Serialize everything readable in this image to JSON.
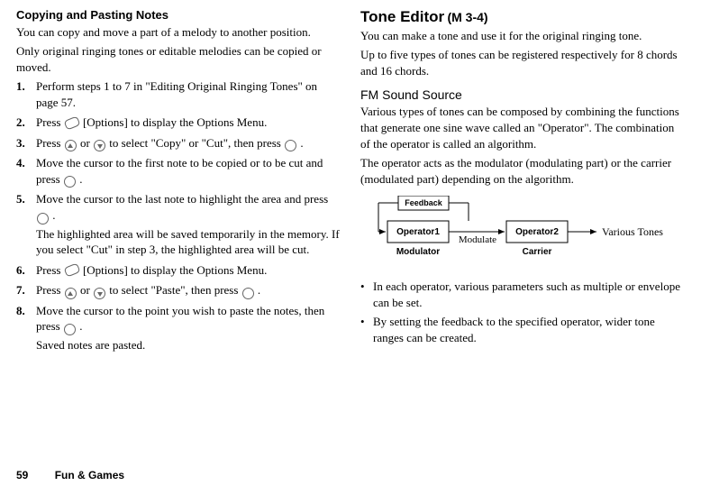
{
  "left": {
    "heading": "Copying and Pasting Notes",
    "intro1": "You can copy and move a part of a melody to another position.",
    "intro2": "Only original ringing tones or editable melodies can be copied or moved.",
    "steps": [
      {
        "n": "1.",
        "text": "Perform steps 1 to 7 in \"Editing Original Ringing Tones\" on page 57."
      },
      {
        "n": "2.",
        "pre": "Press ",
        "post": " [Options] to display the Options Menu."
      },
      {
        "n": "3.",
        "pre": "Press ",
        "mid": " or ",
        "post1": " to select \"Copy\" or \"Cut\", then press ",
        "post2": "."
      },
      {
        "n": "4.",
        "pre": "Move the cursor to the first note to be copied or to be cut and press ",
        "post": "."
      },
      {
        "n": "5.",
        "pre": "Move the cursor to the last note to highlight the area and press ",
        "post": ".",
        "sub": "The highlighted area will be saved temporarily in the memory. If you select \"Cut\" in step 3, the highlighted area will be cut."
      },
      {
        "n": "6.",
        "pre": "Press ",
        "post": " [Options] to display the Options Menu."
      },
      {
        "n": "7.",
        "pre": "Press ",
        "mid": " or ",
        "post1": " to select \"Paste\", then press ",
        "post2": "."
      },
      {
        "n": "8.",
        "pre": "Move the cursor to the point you wish to paste the notes, then press ",
        "post": ".",
        "sub": "Saved notes are pasted."
      }
    ]
  },
  "right": {
    "heading": "Tone Editor",
    "code": "(M 3-4)",
    "p1": "You can make a tone and use it for the original ringing tone.",
    "p2": "Up to five types of tones can be registered respectively for 8 chords and 16 chords.",
    "subheading": "FM Sound Source",
    "p3": "Various types of tones can be composed by combining the functions that generate one sine wave called an \"Operator\". The combination of the operator is called an algorithm.",
    "p4": "The operator acts as the modulator (modulating part) or the carrier (modulated part) depending on the algorithm.",
    "diagram": {
      "feedback": "Feedback",
      "op1": "Operator1",
      "modLabel": "Modulator",
      "modulate": "Modulate",
      "op2": "Operator2",
      "carrier": "Carrier",
      "various": "Various Tones"
    },
    "bullets": [
      "In each operator, various parameters such as multiple or envelope can be set.",
      "By setting the feedback to the specified operator, wider tone ranges can be created."
    ]
  },
  "footer": {
    "page": "59",
    "section": "Fun & Games"
  }
}
